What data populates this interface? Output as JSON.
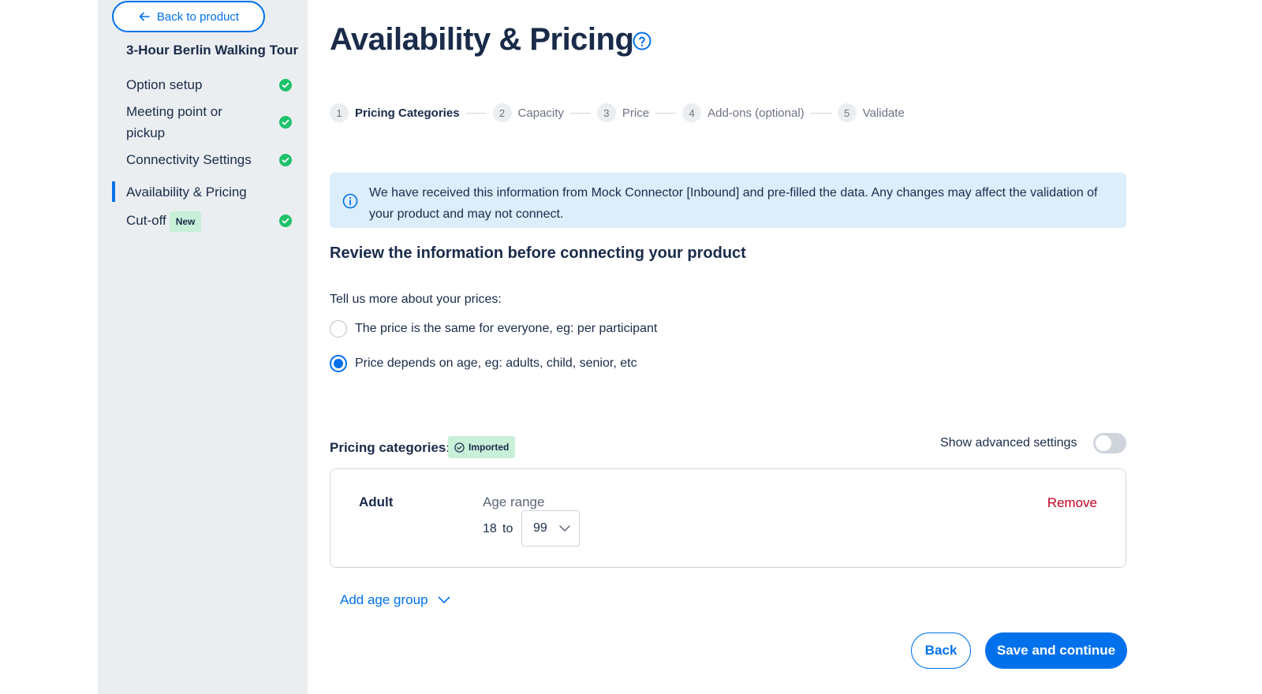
{
  "sidebar": {
    "back_label": "Back to product",
    "product_title": "3-Hour Berlin Walking Tour",
    "items": [
      {
        "label": "Option setup",
        "complete": true
      },
      {
        "label": "Meeting point or pickup",
        "complete": true
      },
      {
        "label": "Connectivity Settings",
        "complete": true
      },
      {
        "label": "Availability & Pricing",
        "complete": false,
        "active": true
      },
      {
        "label": "Cut-off",
        "badge": "New",
        "complete": true
      }
    ]
  },
  "page": {
    "title": "Availability & Pricing"
  },
  "stepper": [
    {
      "num": "1",
      "label": "Pricing Categories",
      "active": true
    },
    {
      "num": "2",
      "label": "Capacity"
    },
    {
      "num": "3",
      "label": "Price"
    },
    {
      "num": "4",
      "label": "Add-ons (optional)"
    },
    {
      "num": "5",
      "label": "Validate"
    }
  ],
  "info": {
    "text": "We have received this information from Mock Connector [Inbound] and pre-filled the data. Any changes may affect the validation of your product and may not connect."
  },
  "review_title": "Review the information before connecting your product",
  "prices": {
    "question": "Tell us more about your prices:",
    "options": [
      {
        "label": "The price is the same for everyone, eg: per participant",
        "selected": false
      },
      {
        "label": "Price depends on age, eg: adults, child, senior, etc",
        "selected": true
      }
    ]
  },
  "pricing_categories": {
    "label": "Pricing categories:",
    "imported_badge": "Imported",
    "advanced_label": "Show advanced settings",
    "advanced_on": false,
    "categories": [
      {
        "name": "Adult",
        "age_label": "Age range",
        "age_from": "18",
        "to_label": "to",
        "age_to": "99",
        "remove_label": "Remove"
      }
    ],
    "add_age_group": "Add age group"
  },
  "footer": {
    "back": "Back",
    "save": "Save and continue"
  },
  "colors": {
    "accent": "#0071eb",
    "success": "#1ec26a",
    "danger": "#c4001f",
    "badge_green": "#c8efd8",
    "info_bg": "#dcedfc"
  }
}
